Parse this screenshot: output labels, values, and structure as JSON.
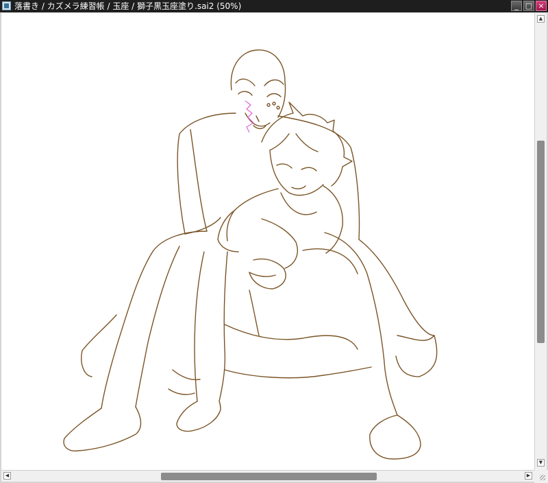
{
  "window": {
    "title": "落書き / カズメラ練習帳 / 玉座 / 獅子黒玉座塗り.sai2 (50%)",
    "app_icon": "document-icon",
    "buttons": {
      "minimize": "_",
      "maximize": "□",
      "close": "×"
    }
  },
  "canvas": {
    "zoom": "50%",
    "background": "#ffffff",
    "line_color": "#7a5426",
    "accent_color": "#e06ad6",
    "subject": "line-art"
  },
  "scrollbars": {
    "vertical": {
      "up_arrow": "▲",
      "down_arrow": "▼"
    },
    "horizontal": {
      "left_arrow": "◀",
      "right_arrow": "▶"
    }
  }
}
